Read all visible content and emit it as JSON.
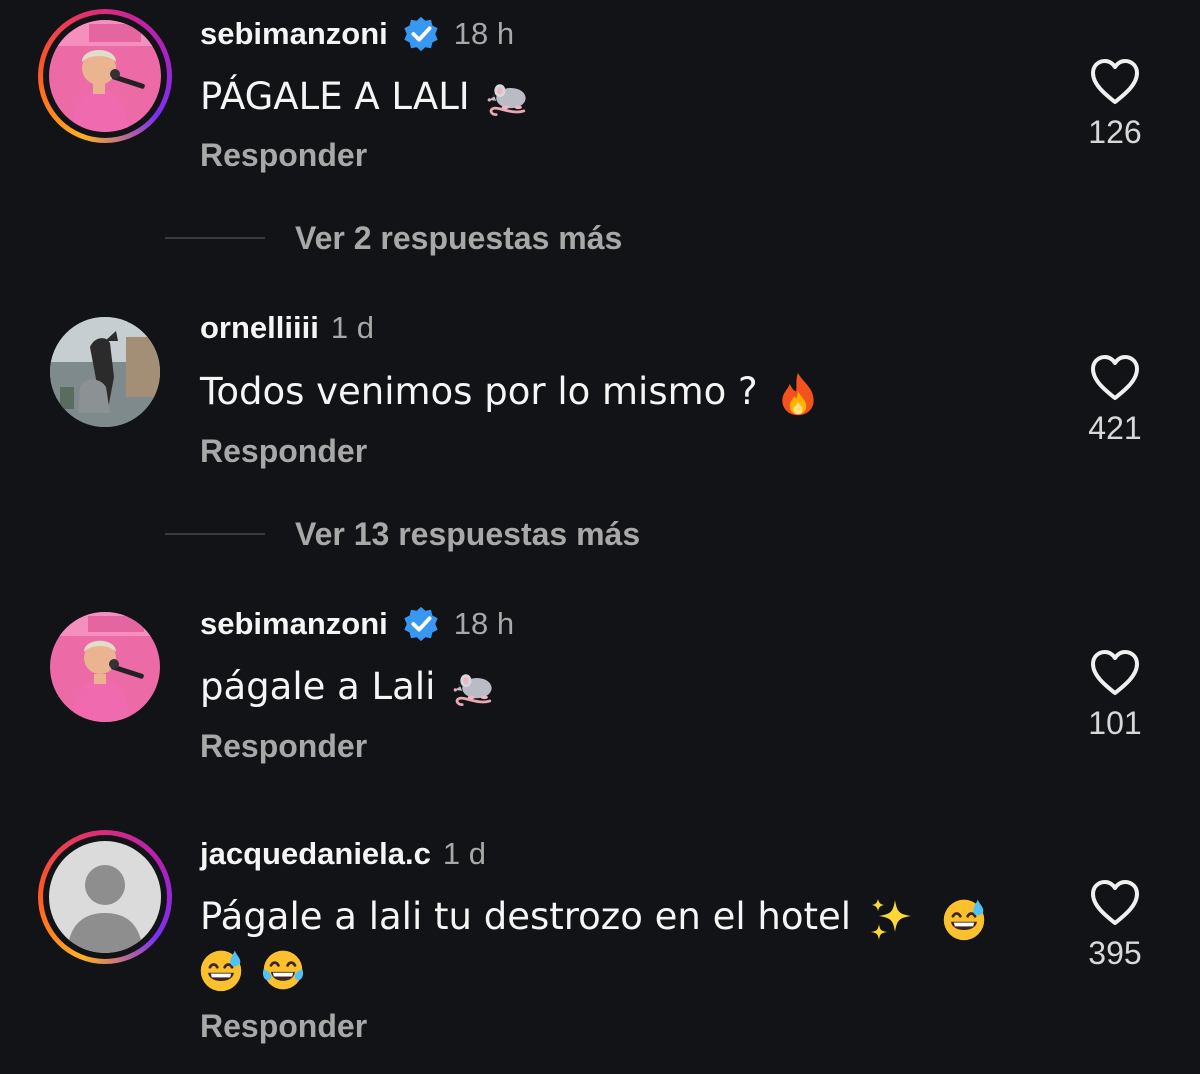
{
  "comments": [
    {
      "username": "sebimanzoni",
      "verified": true,
      "time": "18 h",
      "text": "PÁGALE A LALI",
      "emojis": [
        "rat"
      ],
      "reply_label": "Responder",
      "likes": "126",
      "has_story": true,
      "avatar": "pink-portrait-avatar"
    },
    {
      "username": "ornelliiii",
      "verified": false,
      "time": "1 d",
      "text": "Todos venimos por lo mismo ?",
      "emojis": [
        "fire"
      ],
      "reply_label": "Responder",
      "likes": "421",
      "has_story": false,
      "avatar": "dogs-photo-avatar"
    },
    {
      "username": "sebimanzoni",
      "verified": true,
      "time": "18 h",
      "text": "págale a Lali",
      "emojis": [
        "rat"
      ],
      "reply_label": "Responder",
      "likes": "101",
      "has_story": false,
      "avatar": "pink-portrait-avatar"
    },
    {
      "username": "jacquedaniela.c",
      "verified": false,
      "time": "1 d",
      "text": "Págale a lali tu destrozo en el hotel",
      "emojis": [
        "sparkles",
        "grinning-sweat",
        "grinning-sweat",
        "tears-of-joy"
      ],
      "reply_label": "Responder",
      "likes": "395",
      "has_story": true,
      "avatar": "default-user-avatar"
    }
  ],
  "more_replies": [
    {
      "label": "Ver 2 respuestas más"
    },
    {
      "label": "Ver 13 respuestas más"
    }
  ],
  "colors": {
    "background": "#121316",
    "text_primary": "#f5f5f5",
    "text_secondary": "#a8a8a8",
    "verified_blue": "#3897f0",
    "avatar_pink": "#e85a9c"
  }
}
